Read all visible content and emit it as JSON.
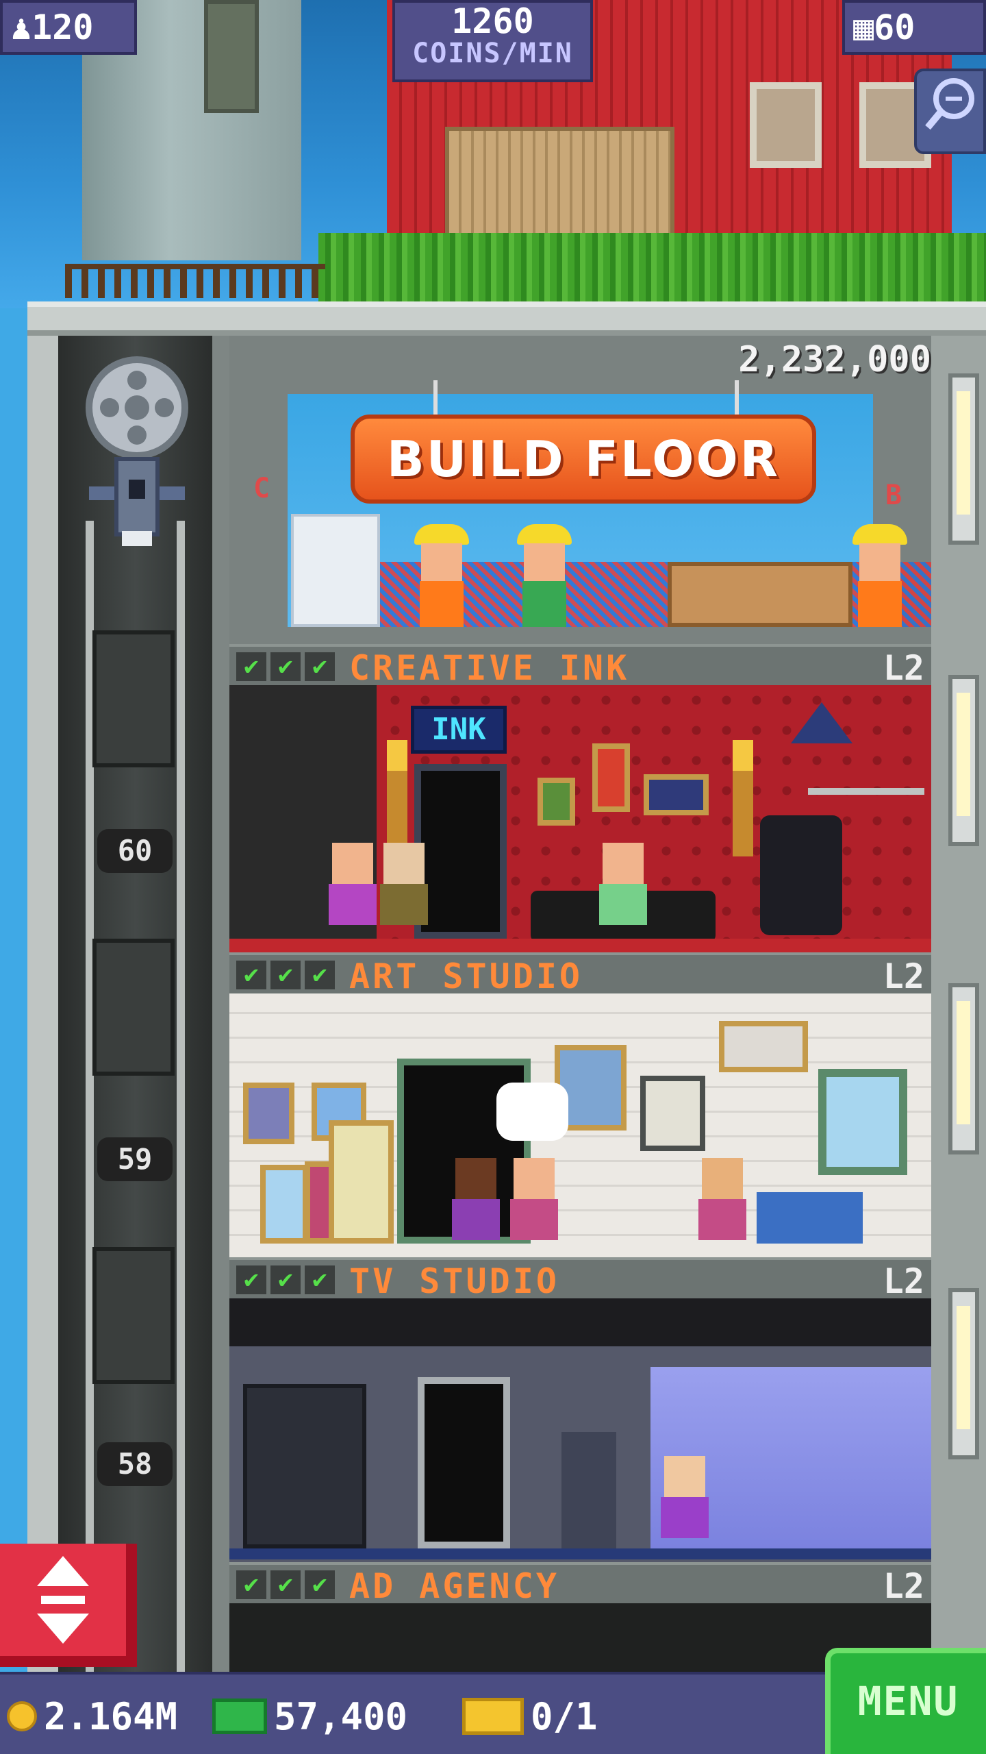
{
  "hud": {
    "population": "120",
    "population_icon": "person-icon",
    "income_value": "1260",
    "income_label": "COINS/MIN",
    "floors_count": "60",
    "floors_icon": "building-icon",
    "zoom_icon": "magnifier-icon"
  },
  "build_floor": {
    "price": "2,232,000",
    "button_label": "BUILD FLOOR",
    "side_left": "C",
    "side_right": "B"
  },
  "elevator": {
    "floor_markers": [
      "60",
      "59",
      "58"
    ],
    "button_icon": "up-down-arrows-icon",
    "button_label": "▲\n▼"
  },
  "floors": [
    {
      "name": "CREATIVE INK",
      "level": "L2",
      "checks": [
        "✔",
        "✔",
        "✔"
      ],
      "sign": "INK"
    },
    {
      "name": "ART STUDIO",
      "level": "L2",
      "checks": [
        "✔",
        "✔",
        "✔"
      ]
    },
    {
      "name": "TV STUDIO",
      "level": "L2",
      "checks": [
        "✔",
        "✔",
        "✔"
      ]
    },
    {
      "name": "AD AGENCY",
      "level": "L2",
      "checks": [
        "✔",
        "✔",
        "✔"
      ]
    }
  ],
  "bottom_bar": {
    "coins": "2.164M",
    "bux": "57,400",
    "tickets": "0/1",
    "menu_label": "MENU"
  },
  "colors": {
    "floor_name": "#ff8a3a",
    "check": "#56e04a",
    "build_button": "#ff7a30",
    "menu_button": "#29b53d",
    "elevator_button": "#e23146",
    "hud_panel": "#514f8a"
  }
}
